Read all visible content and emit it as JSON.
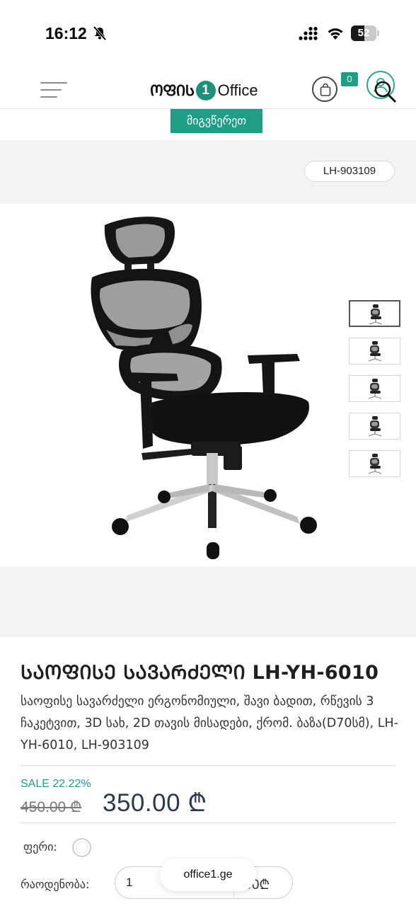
{
  "status_bar": {
    "time": "16:12",
    "battery_level": "52",
    "battery_fraction": 0.52,
    "icons": [
      "bell-off-icon",
      "signal-icon",
      "wifi-icon",
      "battery-icon"
    ]
  },
  "header": {
    "logo_geo": "ᲝᲤᲘᲡ",
    "logo_number": "1",
    "logo_en": "Office",
    "cart_count": "0",
    "icons": [
      "menu-icon",
      "cart-icon",
      "user-icon",
      "search-icon"
    ]
  },
  "contact": {
    "button_label": "მიგვწერეთ"
  },
  "product": {
    "sku": "LH-903109",
    "title": "ᲡᲐᲝᲤᲘᲡᲔ ᲡᲐᲕᲐᲠᲫᲔᲚᲘ LH-YH-6010",
    "description": "საოფისე სავარძელი ერგონომიული, შავი ბადით, რწევის 3 ჩაკეტვით, 3D სახ, 2D თავის მისადები, ქრომ. ბაზა(D70სმ), LH-YH-6010, LH-903109",
    "sale_label": "SALE 22.22%",
    "old_price": "450.00 ₾",
    "new_price": "350.00 ₾",
    "thumbnails": 5,
    "active_thumbnail": 1
  },
  "options": {
    "color_label": "ფერი:",
    "quantity_label": "რაოდენობა:",
    "quantity_value": "1",
    "total": ".00₾"
  },
  "browser": {
    "url": "office1.ge"
  },
  "colors": {
    "brand": "#1f9e87",
    "price": "#2a3a4c"
  }
}
